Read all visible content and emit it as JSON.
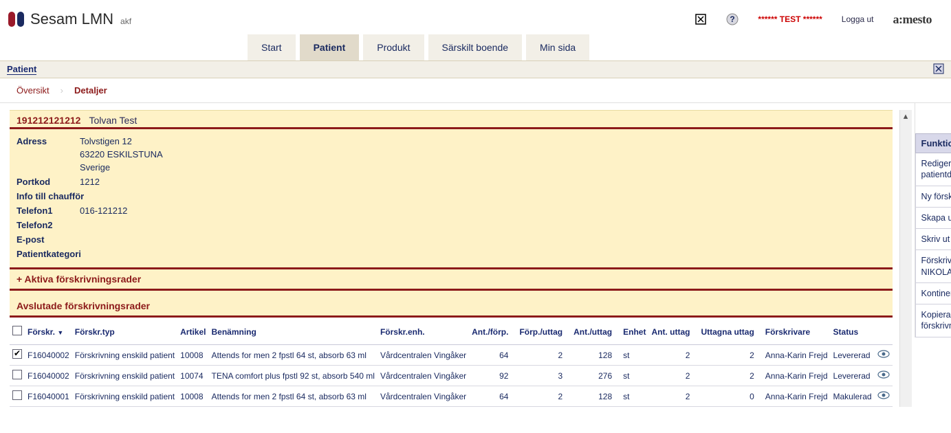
{
  "app": {
    "title": "Sesam LMN",
    "sub": "akf",
    "test_label": "****** TEST ******",
    "logout": "Logga ut",
    "vendor": "a:mesto"
  },
  "tabs": {
    "items": [
      "Start",
      "Patient",
      "Produkt",
      "Särskilt boende",
      "Min sida"
    ],
    "active": 1
  },
  "context": {
    "title": "Patient"
  },
  "breadcrumb": {
    "items": [
      "Översikt",
      "Detaljer"
    ],
    "current": 1
  },
  "patient": {
    "id": "191212121212",
    "name": "Tolvan Test",
    "fields": {
      "adress_label": "Adress",
      "adress_line1": "Tolvstigen 12",
      "adress_line2": "63220 ESKILSTUNA",
      "adress_line3": "Sverige",
      "portkod_label": "Portkod",
      "portkod": "1212",
      "chauffor_label": "Info till chaufför",
      "chauffor": "",
      "tel1_label": "Telefon1",
      "tel1": "016-121212",
      "tel2_label": "Telefon2",
      "tel2": "",
      "epost_label": "E-post",
      "epost": "",
      "kategori_label": "Patientkategori",
      "kategori": ""
    }
  },
  "sections": {
    "aktiva": "+ Aktiva förskrivningsrader",
    "avslutade": "Avslutade förskrivningsrader"
  },
  "table": {
    "headers": {
      "forskr": "Förskr.",
      "forskrtyp": "Förskr.typ",
      "artikel": "Artikel",
      "benamning": "Benämning",
      "forskrenh": "Förskr.enh.",
      "antforp": "Ant./förp.",
      "forputtag": "Förp./uttag",
      "antuttag": "Ant./uttag",
      "enhet": "Enhet",
      "antuttag2": "Ant. uttag",
      "uttagna": "Uttagna uttag",
      "forskrivare": "Förskrivare",
      "status": "Status"
    },
    "rows": [
      {
        "checked": true,
        "forskr": "F16040002",
        "typ": "Förskrivning enskild patient",
        "artikel": "10008",
        "benamning": "Attends for men 2 fpstl 64 st, absorb 63 ml",
        "enh": "Vårdcentralen Vingåker",
        "antforp": "64",
        "forputtag": "2",
        "antuttag": "128",
        "enhet": "st",
        "antuttag2": "2",
        "uttagna": "2",
        "forskrivare": "Anna-Karin Frejd",
        "status": "Levererad"
      },
      {
        "checked": false,
        "forskr": "F16040002",
        "typ": "Förskrivning enskild patient",
        "artikel": "10074",
        "benamning": "TENA comfort plus fpstl 92 st, absorb 540 ml",
        "enh": "Vårdcentralen Vingåker",
        "antforp": "92",
        "forputtag": "3",
        "antuttag": "276",
        "enhet": "st",
        "antuttag2": "2",
        "uttagna": "2",
        "forskrivare": "Anna-Karin Frejd",
        "status": "Levererad"
      },
      {
        "checked": false,
        "forskr": "F16040001",
        "typ": "Förskrivning enskild patient",
        "artikel": "10008",
        "benamning": "Attends for men 2 fpstl 64 st, absorb 63 ml",
        "enh": "Vårdcentralen Vingåker",
        "antforp": "64",
        "forputtag": "2",
        "antuttag": "128",
        "enhet": "st",
        "antuttag2": "2",
        "uttagna": "0",
        "forskrivare": "Anna-Karin Frejd",
        "status": "Makulerad"
      }
    ]
  },
  "functions": {
    "head": "Funktion",
    "items": [
      "Redigera patientdata",
      "Ny förskrivning",
      "Skapa uttag",
      "Skriv ut",
      "Förskrivarstöd - NIKOLA",
      "Kontinenskort",
      "Kopiera förskrivningsrader"
    ]
  }
}
